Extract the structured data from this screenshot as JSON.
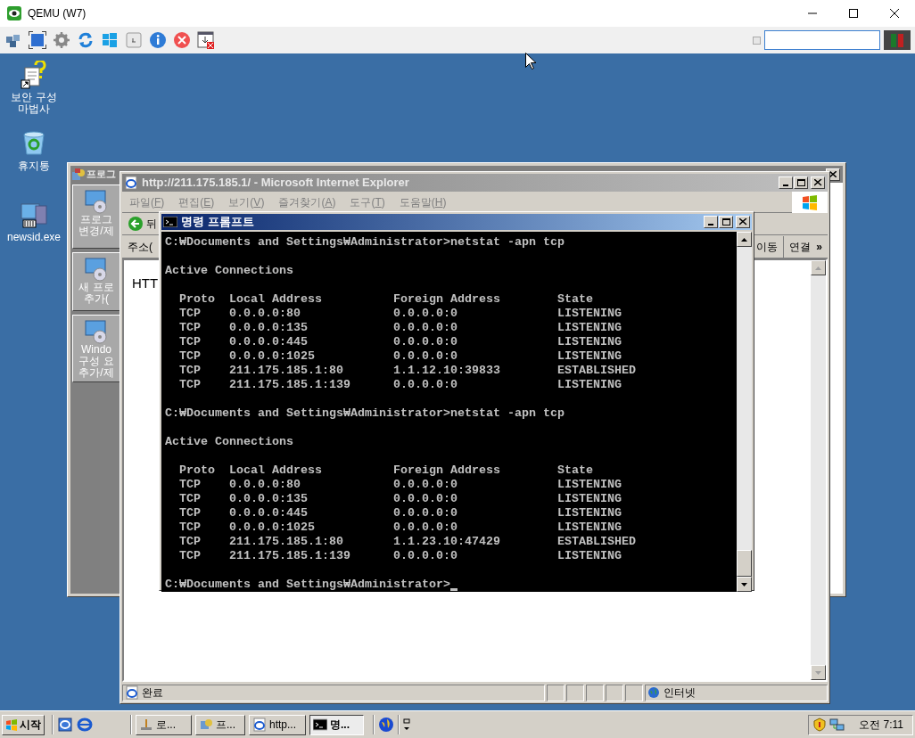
{
  "window": {
    "title": "QEMU (W7)"
  },
  "desktop_icons": [
    {
      "kind": "wizard",
      "label": "보안 구성 마법사"
    },
    {
      "kind": "recycle-bin",
      "label": "휴지통"
    },
    {
      "kind": "program",
      "label": "newsid.exe"
    }
  ],
  "back_window": {
    "title": "프로그",
    "tasks": [
      {
        "lines": [
          "프로그",
          "변경/제"
        ]
      },
      {
        "lines": [
          "새 프로",
          "추가("
        ]
      },
      {
        "lines": [
          "Windo",
          "구성 요",
          "추가/제"
        ]
      }
    ]
  },
  "browser": {
    "title": "http://211.175.185.1/ - Microsoft Internet Explorer",
    "menu": [
      {
        "label": "파일(F)"
      },
      {
        "label": "편집(E)"
      },
      {
        "label": "보기(V)"
      },
      {
        "label": "즐겨찾기(A)"
      },
      {
        "label": "도구(T)"
      },
      {
        "label": "도움말(H)"
      }
    ],
    "back_label": "뒤",
    "address_label": "주소(",
    "go_label": "이동",
    "links_label": "연결",
    "more_label": "»",
    "content": "HTT",
    "status": "완료",
    "zone": "인터넷"
  },
  "console": {
    "title": "명령 프롬프트",
    "sessions": [
      {
        "prompt": "C:₩Documents and Settings₩Administrator>",
        "command": "netstat -apn tcp",
        "heading": "Active Connections",
        "columns": [
          "Proto",
          "Local Address",
          "Foreign Address",
          "State"
        ],
        "rows": [
          [
            "TCP",
            "0.0.0.0:80",
            "0.0.0.0:0",
            "LISTENING"
          ],
          [
            "TCP",
            "0.0.0.0:135",
            "0.0.0.0:0",
            "LISTENING"
          ],
          [
            "TCP",
            "0.0.0.0:445",
            "0.0.0.0:0",
            "LISTENING"
          ],
          [
            "TCP",
            "0.0.0.0:1025",
            "0.0.0.0:0",
            "LISTENING"
          ],
          [
            "TCP",
            "211.175.185.1:80",
            "1.1.12.10:39833",
            "ESTABLISHED"
          ],
          [
            "TCP",
            "211.175.185.1:139",
            "0.0.0.0:0",
            "LISTENING"
          ]
        ]
      },
      {
        "prompt": "C:₩Documents and Settings₩Administrator>",
        "command": "netstat -apn tcp",
        "heading": "Active Connections",
        "columns": [
          "Proto",
          "Local Address",
          "Foreign Address",
          "State"
        ],
        "rows": [
          [
            "TCP",
            "0.0.0.0:80",
            "0.0.0.0:0",
            "LISTENING"
          ],
          [
            "TCP",
            "0.0.0.0:135",
            "0.0.0.0:0",
            "LISTENING"
          ],
          [
            "TCP",
            "0.0.0.0:445",
            "0.0.0.0:0",
            "LISTENING"
          ],
          [
            "TCP",
            "0.0.0.0:1025",
            "0.0.0.0:0",
            "LISTENING"
          ],
          [
            "TCP",
            "211.175.185.1:80",
            "1.1.23.10:47429",
            "ESTABLISHED"
          ],
          [
            "TCP",
            "211.175.185.1:139",
            "0.0.0.0:0",
            "LISTENING"
          ]
        ]
      }
    ],
    "final_prompt": "C:₩Documents and Settings₩Administrator>"
  },
  "taskbar": {
    "start": "시작",
    "tasks": [
      {
        "label": "로...",
        "selected": false
      },
      {
        "label": "프...",
        "selected": false
      },
      {
        "label": "http...",
        "selected": false
      },
      {
        "label": "명...",
        "selected": true
      }
    ],
    "clock": "오전 7:11"
  }
}
